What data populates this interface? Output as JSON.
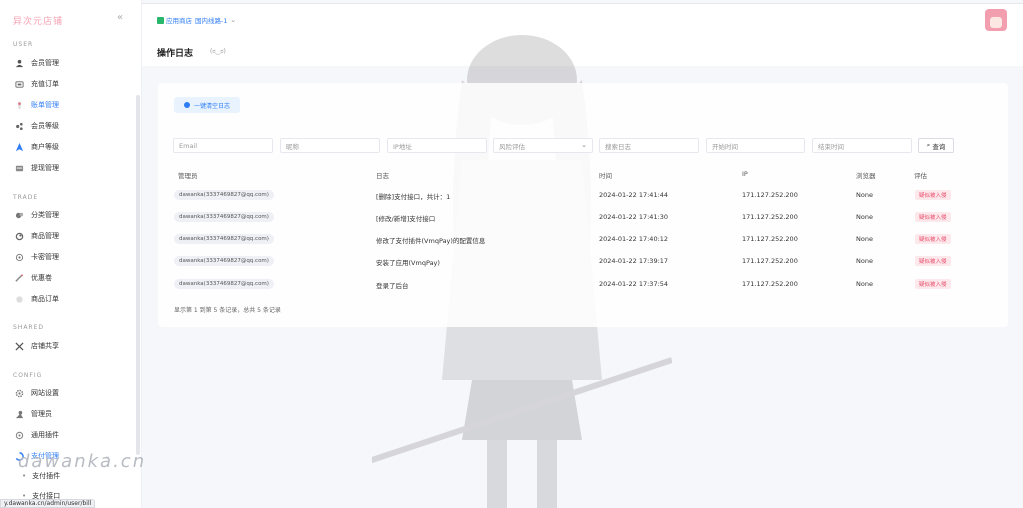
{
  "sidebar": {
    "brand": "异次元店铺",
    "sections": [
      {
        "key": "user",
        "title": "USER",
        "items": [
          {
            "label": "会员管理",
            "icon": "user-icon"
          },
          {
            "label": "充值订单",
            "icon": "recharge-icon"
          },
          {
            "label": "账单管理",
            "icon": "bill-icon",
            "active": true
          },
          {
            "label": "会员等级",
            "icon": "level-icon"
          },
          {
            "label": "商户等级",
            "icon": "merchant-icon"
          },
          {
            "label": "提现管理",
            "icon": "withdraw-icon"
          }
        ]
      },
      {
        "key": "trade",
        "title": "TRADE",
        "items": [
          {
            "label": "分类管理",
            "icon": "category-icon"
          },
          {
            "label": "商品管理",
            "icon": "goods-icon"
          },
          {
            "label": "卡密管理",
            "icon": "card-icon"
          },
          {
            "label": "优惠卷",
            "icon": "coupon-icon"
          },
          {
            "label": "商品订单",
            "icon": "order-icon"
          }
        ]
      },
      {
        "key": "shared",
        "title": "SHARED",
        "items": [
          {
            "label": "店铺共享",
            "icon": "share-icon"
          }
        ]
      },
      {
        "key": "config",
        "title": "CONFIG",
        "items": [
          {
            "label": "网站设置",
            "icon": "settings-icon"
          },
          {
            "label": "管理员",
            "icon": "admin-icon"
          },
          {
            "label": "通用插件",
            "icon": "plugin-icon"
          },
          {
            "label": "支付管理",
            "icon": "pay-icon",
            "active": true,
            "expanded": true
          }
        ]
      }
    ],
    "sub_items": [
      "支付插件",
      "支付接口"
    ],
    "status_url": "y.dawanka.cn/admin/user/bill"
  },
  "watermark": "dawanka.cn",
  "topbar": {
    "store_label": "应用商店",
    "line_label": "国内线路-1"
  },
  "page": {
    "title": "操作日志",
    "subtitle": "(ಠ‿ಠ)"
  },
  "actions": {
    "clear_label": "一键清空日志"
  },
  "filters": {
    "email": "Email",
    "nickname": "昵称",
    "ip": "IP地址",
    "risk": "风险评估",
    "search": "搜索日志",
    "start": "开始时间",
    "end": "结束时间",
    "query": "查询"
  },
  "table": {
    "columns": [
      "管理员",
      "日志",
      "时间",
      "IP",
      "浏览器",
      "评估"
    ],
    "rows": [
      {
        "admin": "dawanka(3337469827@qq.com)",
        "log": "[删除]支付接口，共计：1",
        "time": "2024-01-22 17:41:44",
        "ip": "171.127.252.200",
        "browser": "None",
        "risk": "疑似被入侵"
      },
      {
        "admin": "dawanka(3337469827@qq.com)",
        "log": "[修改/新增]支付接口",
        "time": "2024-01-22 17:41:30",
        "ip": "171.127.252.200",
        "browser": "None",
        "risk": "疑似被入侵"
      },
      {
        "admin": "dawanka(3337469827@qq.com)",
        "log": "修改了支付插件(VmqPay)的配置信息",
        "time": "2024-01-22 17:40:12",
        "ip": "171.127.252.200",
        "browser": "None",
        "risk": "疑似被入侵"
      },
      {
        "admin": "dawanka(3337469827@qq.com)",
        "log": "安装了应用(VmqPay)",
        "time": "2024-01-22 17:39:17",
        "ip": "171.127.252.200",
        "browser": "None",
        "risk": "疑似被入侵"
      },
      {
        "admin": "dawanka(3337469827@qq.com)",
        "log": "登录了后台",
        "time": "2024-01-22 17:37:54",
        "ip": "171.127.252.200",
        "browser": "None",
        "risk": "疑似被入侵"
      }
    ],
    "footer": "显示第 1 到第 5 条记录，总共 5 条记录"
  },
  "colors": {
    "accent": "#2f7df6",
    "brand": "#f5a3b3",
    "danger": "#e84d6b"
  }
}
